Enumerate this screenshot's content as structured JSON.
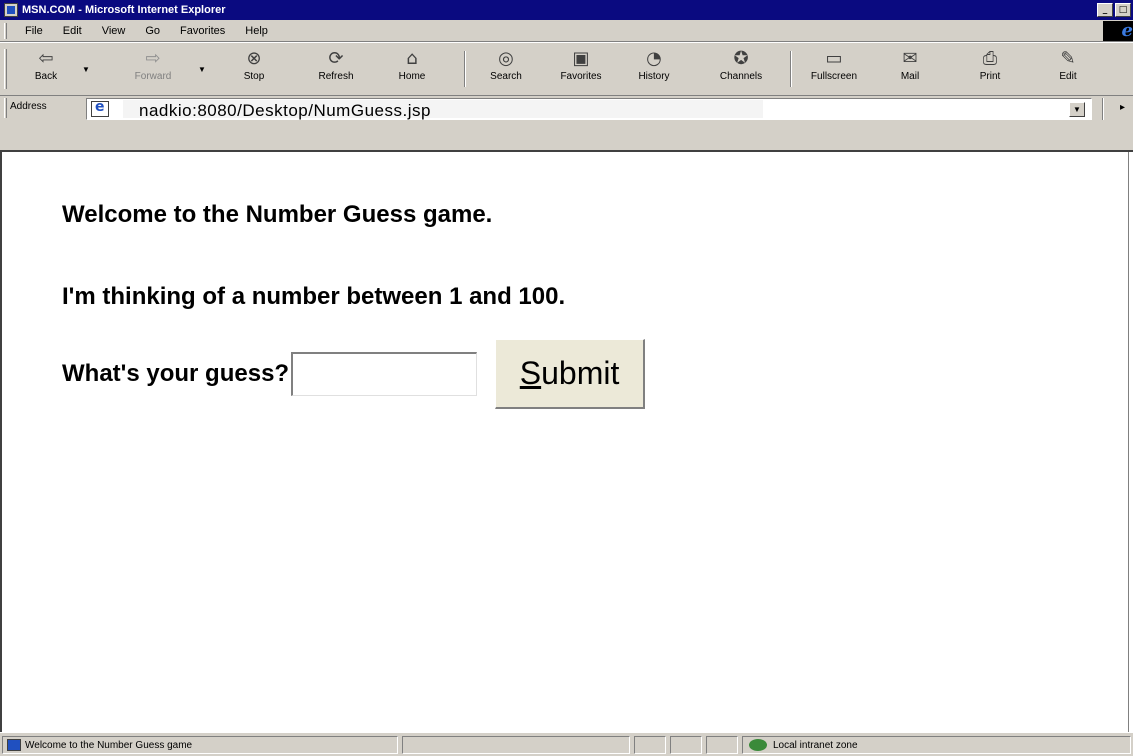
{
  "window": {
    "title": "MSN.COM - Microsoft Internet Explorer",
    "controls": [
      "_",
      "□"
    ]
  },
  "menu": {
    "items": [
      "File",
      "Edit",
      "View",
      "Go",
      "Favorites",
      "Help"
    ]
  },
  "toolbar": {
    "buttons": [
      {
        "label": "Back",
        "icon": "back-arrow-icon",
        "glyph": "⇦"
      },
      {
        "label": "Forward",
        "icon": "forward-arrow-icon",
        "glyph": "⇨"
      },
      {
        "label": "Stop",
        "icon": "stop-icon",
        "glyph": "⊗"
      },
      {
        "label": "Refresh",
        "icon": "refresh-icon",
        "glyph": "⟳"
      },
      {
        "label": "Home",
        "icon": "home-icon",
        "glyph": "⌂"
      },
      {
        "label": "Search",
        "icon": "search-icon",
        "glyph": "◎"
      },
      {
        "label": "Favorites",
        "icon": "favorites-icon",
        "glyph": "▣"
      },
      {
        "label": "History",
        "icon": "history-icon",
        "glyph": "◔"
      },
      {
        "label": "Channels",
        "icon": "channels-icon",
        "glyph": "✪"
      },
      {
        "label": "Fullscreen",
        "icon": "fullscreen-icon",
        "glyph": "▭"
      },
      {
        "label": "Mail",
        "icon": "mail-icon",
        "glyph": "✉"
      },
      {
        "label": "Print",
        "icon": "print-icon",
        "glyph": "⎙"
      },
      {
        "label": "Edit",
        "icon": "edit-icon",
        "glyph": "✎"
      }
    ]
  },
  "address": {
    "label": "Address",
    "url": "nadkio:8080/Desktop/NumGuess.jsp"
  },
  "page": {
    "welcome": "Welcome to the Number Guess game.",
    "thinking": "I'm thinking of a number between 1 and 100.",
    "prompt": "What's your guess?",
    "guess_value": "",
    "submit_first": "S",
    "submit_rest": "ubmit"
  },
  "status": {
    "message": "Welcome to the Number Guess game",
    "zone": "Local intranet zone"
  }
}
